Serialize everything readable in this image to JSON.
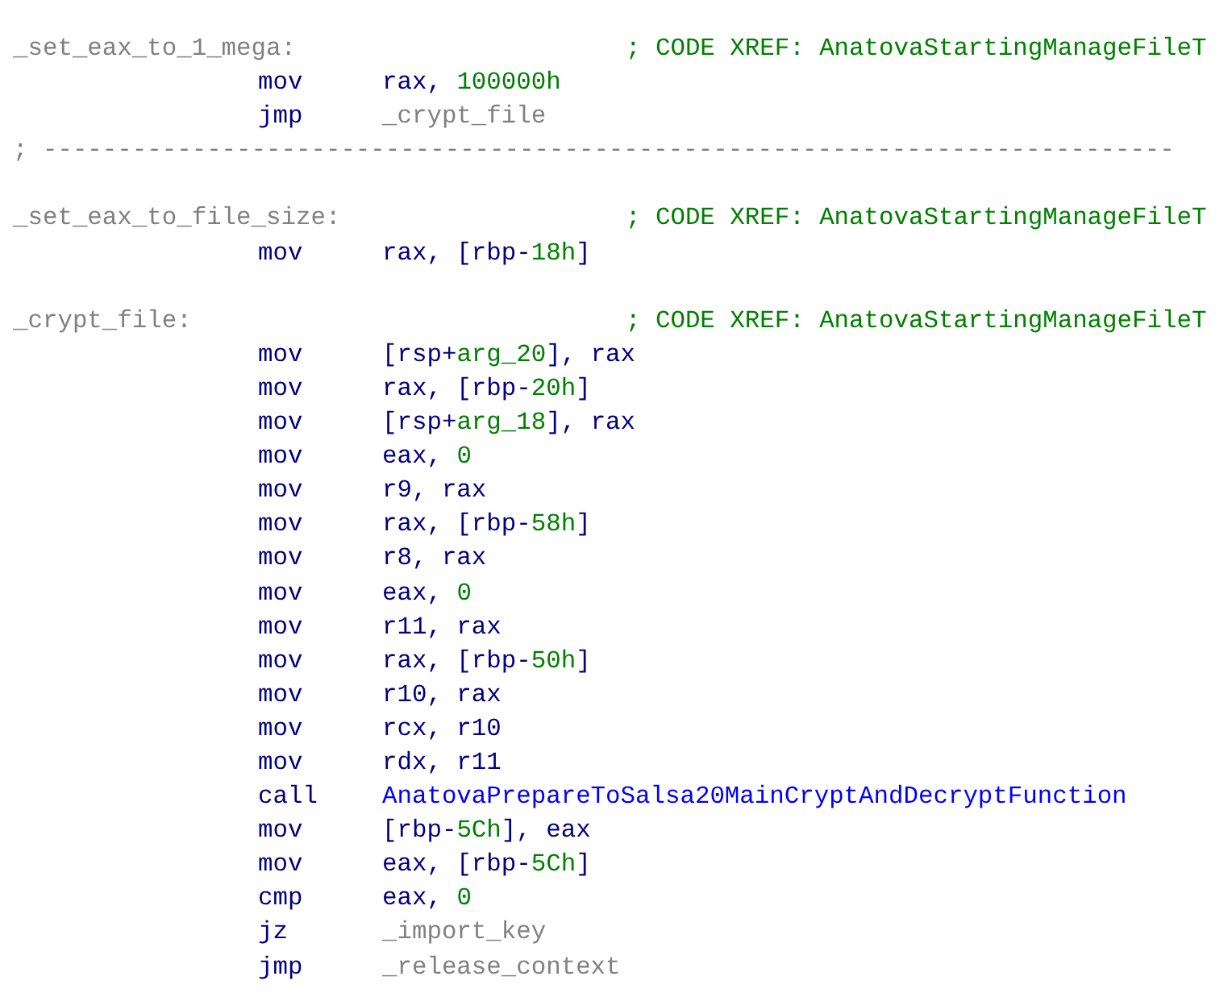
{
  "listing": [
    {
      "kind": "label",
      "label": "_set_eax_to_1_mega:",
      "comment": "; CODE XREF: AnatovaStartingManageFileT"
    },
    {
      "kind": "instr",
      "mnemonic": "mov",
      "operand": [
        {
          "text": "rax, ",
          "kind": "reg"
        },
        {
          "text": "100000h",
          "kind": "num"
        }
      ]
    },
    {
      "kind": "instr",
      "mnemonic": "jmp",
      "operand": [
        {
          "text": "_crypt_file",
          "kind": "loc"
        }
      ]
    },
    {
      "kind": "separator",
      "text": "; ----------------------------------------------------------------------------"
    },
    {
      "kind": "blank"
    },
    {
      "kind": "label",
      "label": "_set_eax_to_file_size:",
      "comment": "; CODE XREF: AnatovaStartingManageFileT"
    },
    {
      "kind": "instr",
      "mnemonic": "mov",
      "operand": [
        {
          "text": "rax, [rbp-",
          "kind": "reg"
        },
        {
          "text": "18h",
          "kind": "num"
        },
        {
          "text": "]",
          "kind": "reg"
        }
      ]
    },
    {
      "kind": "blank"
    },
    {
      "kind": "label",
      "label": "_crypt_file:",
      "comment": "; CODE XREF: AnatovaStartingManageFileT"
    },
    {
      "kind": "instr",
      "mnemonic": "mov",
      "operand": [
        {
          "text": "[rsp+",
          "kind": "reg"
        },
        {
          "text": "arg_20",
          "kind": "num"
        },
        {
          "text": "], rax",
          "kind": "reg"
        }
      ]
    },
    {
      "kind": "instr",
      "mnemonic": "mov",
      "operand": [
        {
          "text": "rax, [rbp-",
          "kind": "reg"
        },
        {
          "text": "20h",
          "kind": "num"
        },
        {
          "text": "]",
          "kind": "reg"
        }
      ]
    },
    {
      "kind": "instr",
      "mnemonic": "mov",
      "operand": [
        {
          "text": "[rsp+",
          "kind": "reg"
        },
        {
          "text": "arg_18",
          "kind": "num"
        },
        {
          "text": "], rax",
          "kind": "reg"
        }
      ]
    },
    {
      "kind": "instr",
      "mnemonic": "mov",
      "operand": [
        {
          "text": "eax, ",
          "kind": "reg"
        },
        {
          "text": "0",
          "kind": "num"
        }
      ]
    },
    {
      "kind": "instr",
      "mnemonic": "mov",
      "operand": [
        {
          "text": "r9, rax",
          "kind": "reg"
        }
      ]
    },
    {
      "kind": "instr",
      "mnemonic": "mov",
      "operand": [
        {
          "text": "rax, [rbp-",
          "kind": "reg"
        },
        {
          "text": "58h",
          "kind": "num"
        },
        {
          "text": "]",
          "kind": "reg"
        }
      ]
    },
    {
      "kind": "instr",
      "mnemonic": "mov",
      "operand": [
        {
          "text": "r8, rax",
          "kind": "reg"
        }
      ]
    },
    {
      "kind": "instr",
      "mnemonic": "mov",
      "operand": [
        {
          "text": "eax, ",
          "kind": "reg"
        },
        {
          "text": "0",
          "kind": "num"
        }
      ]
    },
    {
      "kind": "instr",
      "mnemonic": "mov",
      "operand": [
        {
          "text": "r11, rax",
          "kind": "reg"
        }
      ]
    },
    {
      "kind": "instr",
      "mnemonic": "mov",
      "operand": [
        {
          "text": "rax, [rbp-",
          "kind": "reg"
        },
        {
          "text": "50h",
          "kind": "num"
        },
        {
          "text": "]",
          "kind": "reg"
        }
      ]
    },
    {
      "kind": "instr",
      "mnemonic": "mov",
      "operand": [
        {
          "text": "r10, rax",
          "kind": "reg"
        }
      ]
    },
    {
      "kind": "instr",
      "mnemonic": "mov",
      "operand": [
        {
          "text": "rcx, r10",
          "kind": "reg"
        }
      ]
    },
    {
      "kind": "instr",
      "mnemonic": "mov",
      "operand": [
        {
          "text": "rdx, r11",
          "kind": "reg"
        }
      ]
    },
    {
      "kind": "instr",
      "mnemonic": "call",
      "operand": [
        {
          "text": "AnatovaPrepareToSalsa20MainCryptAndDecryptFunction",
          "kind": "func"
        }
      ]
    },
    {
      "kind": "instr",
      "mnemonic": "mov",
      "operand": [
        {
          "text": "[rbp-",
          "kind": "reg"
        },
        {
          "text": "5Ch",
          "kind": "num"
        },
        {
          "text": "], eax",
          "kind": "reg"
        }
      ]
    },
    {
      "kind": "instr",
      "mnemonic": "mov",
      "operand": [
        {
          "text": "eax, [rbp-",
          "kind": "reg"
        },
        {
          "text": "5Ch",
          "kind": "num"
        },
        {
          "text": "]",
          "kind": "reg"
        }
      ]
    },
    {
      "kind": "instr",
      "mnemonic": "cmp",
      "operand": [
        {
          "text": "eax, ",
          "kind": "reg"
        },
        {
          "text": "0",
          "kind": "num"
        }
      ]
    },
    {
      "kind": "instr",
      "mnemonic": "jz",
      "operand": [
        {
          "text": "_import_key",
          "kind": "loc"
        }
      ]
    },
    {
      "kind": "instr",
      "mnemonic": "jmp",
      "operand": [
        {
          "text": "_release_context",
          "kind": "loc"
        }
      ]
    }
  ]
}
